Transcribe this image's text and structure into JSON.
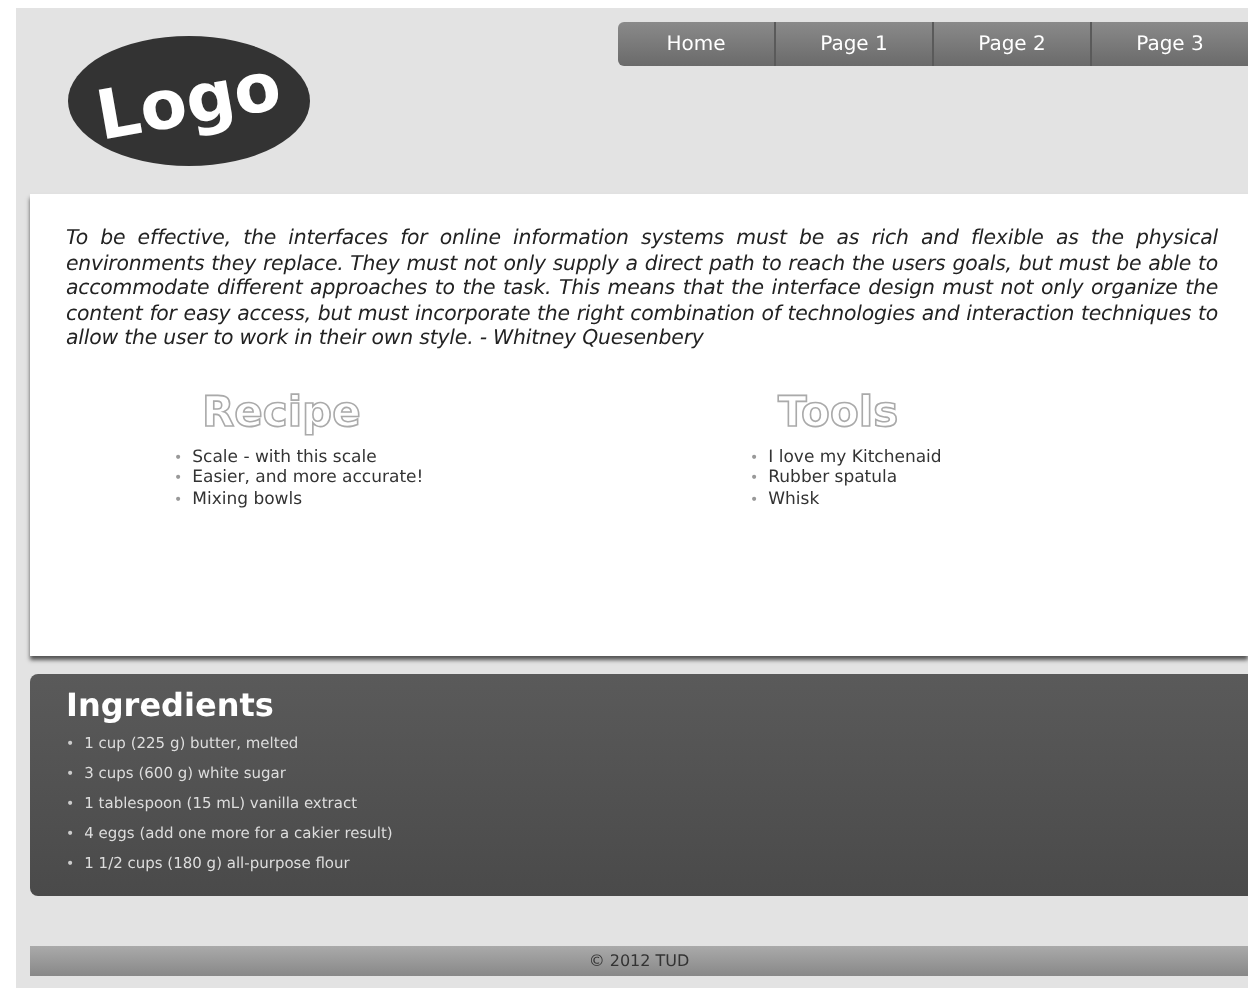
{
  "logo": {
    "text": "Logo"
  },
  "nav": [
    {
      "label": "Home"
    },
    {
      "label": "Page 1"
    },
    {
      "label": "Page 2"
    },
    {
      "label": "Page 3"
    }
  ],
  "quote": "To be effective, the interfaces for online information systems must be as rich and flexible as the physical environments they replace. They must not only supply a direct path to reach the users goals, but must be able to accommodate different approaches to the task. This means that the interface design must not only organize the content for easy access, but must incorporate the right combination of technologies and interaction techniques to allow the user to work in their own style. - Whitney Quesenbery",
  "bullet": "•",
  "columns": [
    {
      "title": "Recipe",
      "items": [
        "Scale - with this scale",
        "Easier, and more accurate!",
        "Mixing bowls"
      ]
    },
    {
      "title": "Tools",
      "items": [
        "I love my Kitchenaid",
        "Rubber spatula",
        "Whisk"
      ]
    }
  ],
  "ingredients": {
    "title": "Ingredients",
    "items": [
      "1 cup (225 g) butter, melted",
      "3 cups (600 g) white sugar",
      "1 tablespoon (15 mL) vanilla extract",
      "4 eggs (add one more for a cakier result)",
      "1 1/2 cups (180 g) all-purpose flour"
    ]
  },
  "footer": "© 2012 TUD"
}
